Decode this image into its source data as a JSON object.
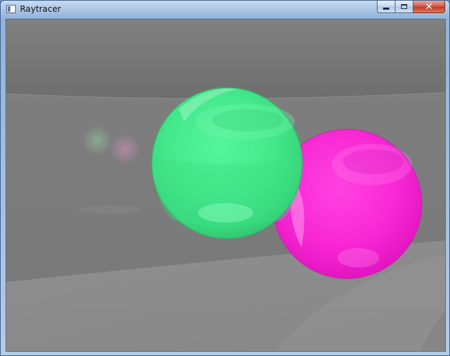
{
  "window": {
    "title": "Raytracer",
    "caption_buttons": [
      "minimize",
      "maximize",
      "close"
    ]
  },
  "icons": {
    "app": "window-icon",
    "minimize": "minimize-icon",
    "maximize": "maximize-icon",
    "close": "close-icon"
  },
  "scene": {
    "objects": [
      {
        "kind": "sphere",
        "name": "green",
        "color": "#3fe887"
      },
      {
        "kind": "sphere",
        "name": "magenta",
        "color": "#ff24d6"
      }
    ],
    "colors": {
      "floor": "#8a8a8a",
      "wall": "#7a7a7a",
      "ceiling": "#6e6e6e"
    }
  }
}
